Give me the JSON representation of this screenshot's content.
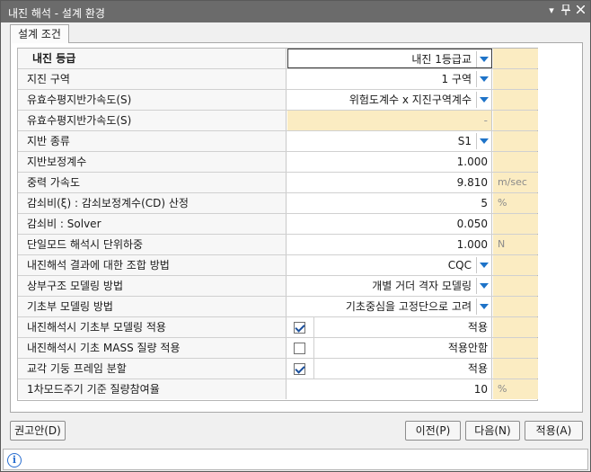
{
  "window": {
    "title": "내진 해석 - 설계 환경",
    "controls": {
      "dropdown": "▾",
      "pin": "📌",
      "close": "✕"
    }
  },
  "tab": {
    "label": "설계 조건"
  },
  "rows": [
    {
      "label": "내진 등급",
      "value": "내진 1등급교",
      "dropdown": true,
      "unit": ""
    },
    {
      "label": "지진 구역",
      "value": "1 구역",
      "dropdown": true,
      "unit": ""
    },
    {
      "label": "유효수평지반가속도(S)",
      "value": "위험도계수 x 지진구역계수",
      "dropdown": true,
      "unit": ""
    },
    {
      "label": "유효수평지반가속도(S)",
      "value": "-",
      "disabled": true,
      "unit": ""
    },
    {
      "label": "지반 종류",
      "value": "S1",
      "dropdown": true,
      "unit": ""
    },
    {
      "label": "지반보정계수",
      "value": "1.000",
      "unit": ""
    },
    {
      "label": "중력 가속도",
      "value": "9.810",
      "unit": "m/sec"
    },
    {
      "label": "감쇠비(ξ) : 감쇠보정계수(CD) 산정",
      "value": "5",
      "unit": "%"
    },
    {
      "label": "감쇠비 : Solver",
      "value": "0.050",
      "unit": ""
    },
    {
      "label": "단일모드 해석시 단위하중",
      "value": "1.000",
      "unit": "N"
    },
    {
      "label": "내진해석 결과에 대한 조합 방법",
      "value": "CQC",
      "dropdown": true,
      "unit": ""
    },
    {
      "label": "상부구조 모델링 방법",
      "value": "개별 거더 격자 모델링",
      "dropdown": true,
      "unit": ""
    },
    {
      "label": "기초부 모델링 방법",
      "value": "기초중심을 고정단으로 고려",
      "dropdown": true,
      "unit": ""
    },
    {
      "label": "내진해석시 기초부  모델링 적용",
      "value": "적용",
      "checkbox": true,
      "checked": true,
      "unit": ""
    },
    {
      "label": "내진해석시 기초 MASS 질량 적용",
      "value": "적용안함",
      "checkbox": true,
      "checked": false,
      "unit": ""
    },
    {
      "label": "교각 기둥 프레임 분할",
      "value": "적용",
      "checkbox": true,
      "checked": true,
      "unit": ""
    },
    {
      "label": "1차모드주기 기준 질량참여율",
      "value": "10",
      "unit": "%"
    }
  ],
  "buttons": {
    "recommend": "권고안(D)",
    "prev": "이전(P)",
    "next": "다음(N)",
    "apply": "적용(A)"
  },
  "status": {
    "icon": "info-icon",
    "text": ""
  },
  "colors": {
    "titlebar": "#6b6b6b",
    "disabled_cell": "#fbecc2",
    "dropdown_arrow": "#1e73c8"
  }
}
